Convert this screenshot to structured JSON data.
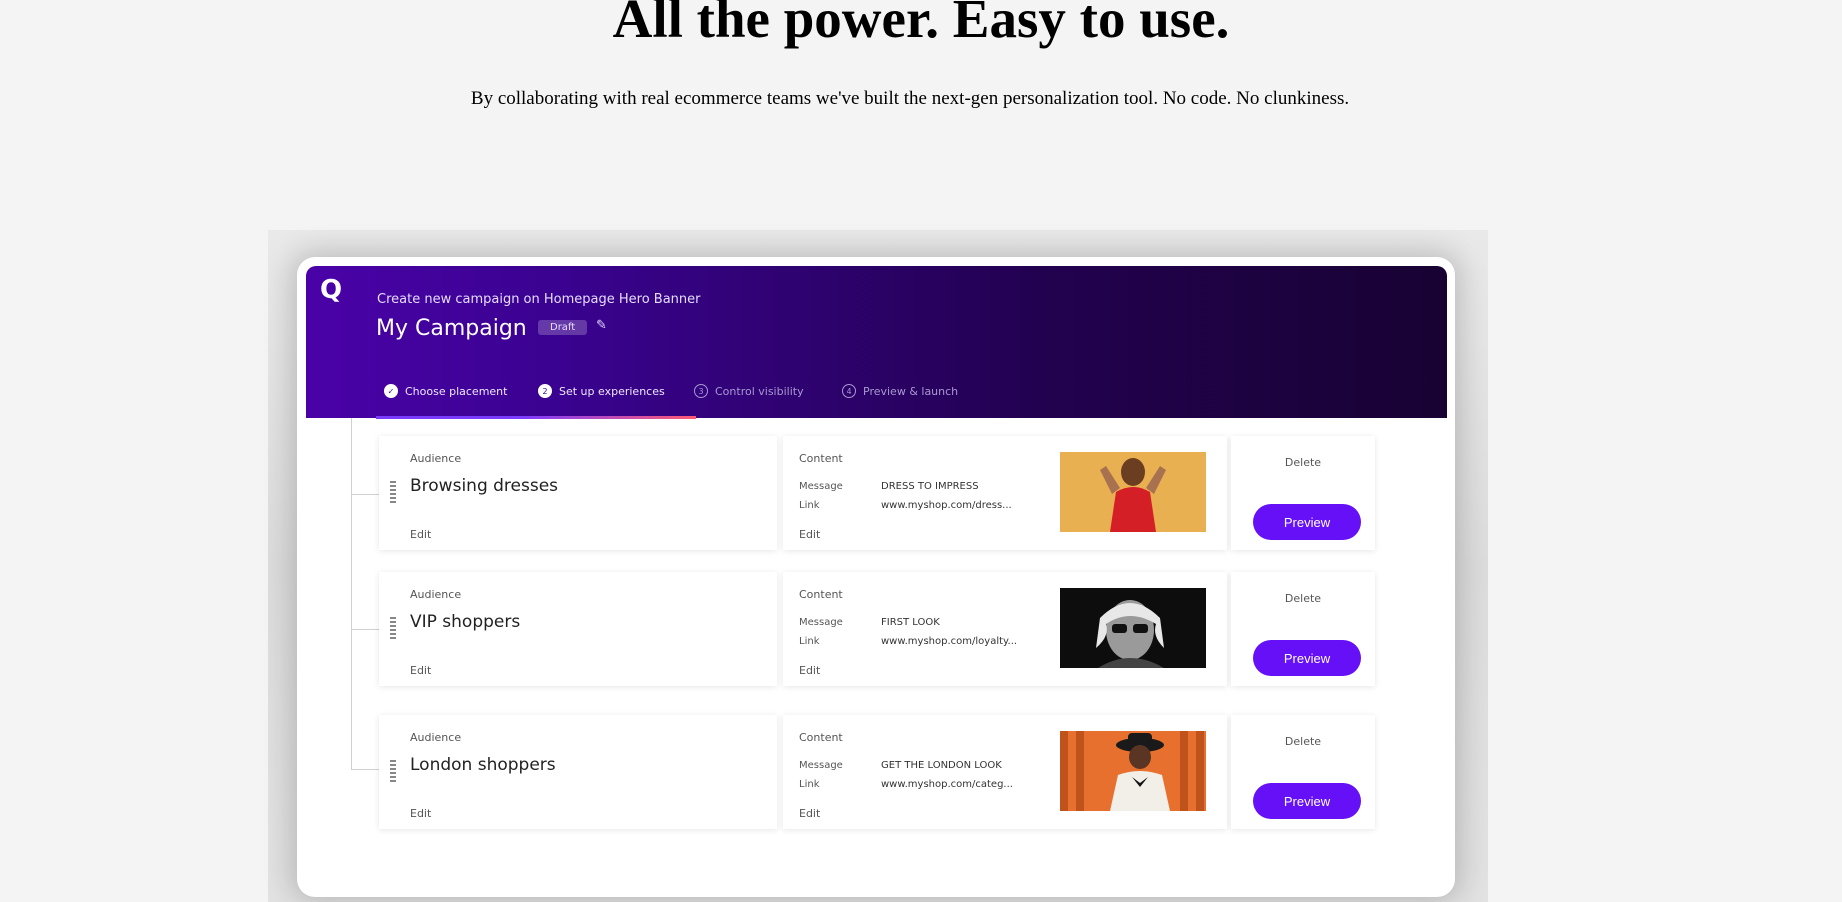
{
  "hero": {
    "title": "All the power. Easy to use.",
    "subtitle": "By collaborating with real ecommerce teams we've built the next-gen personalization tool. No code. No clunkiness."
  },
  "app": {
    "logo": "Q",
    "breadcrumb": "Create new campaign on Homepage Hero Banner",
    "campaign_title": "My Campaign",
    "status_badge": "Draft",
    "steps": [
      {
        "label": "Choose placement",
        "state": "done",
        "marker": "✓"
      },
      {
        "label": "Set up experiences",
        "state": "current",
        "marker": "2"
      },
      {
        "label": "Control visibility",
        "state": "todo",
        "marker": "3"
      },
      {
        "label": "Preview & launch",
        "state": "todo",
        "marker": "4"
      }
    ],
    "colors": {
      "header_start": "#4a02a8",
      "header_end": "#180233",
      "accent": "#6510f6"
    },
    "experiences": [
      {
        "audience_label": "Audience",
        "audience_name": "Browsing dresses",
        "audience_edit": "Edit",
        "content_label": "Content",
        "message_key": "Message",
        "message_value": "DRESS TO IMPRESS",
        "link_key": "Link",
        "link_value": "www.myshop.com/dress...",
        "content_edit": "Edit",
        "delete": "Delete",
        "preview": "Preview"
      },
      {
        "audience_label": "Audience",
        "audience_name": "VIP shoppers",
        "audience_edit": "Edit",
        "content_label": "Content",
        "message_key": "Message",
        "message_value": "FIRST LOOK",
        "link_key": "Link",
        "link_value": "www.myshop.com/loyalty...",
        "content_edit": "Edit",
        "delete": "Delete",
        "preview": "Preview"
      },
      {
        "audience_label": "Audience",
        "audience_name": "London shoppers",
        "audience_edit": "Edit",
        "content_label": "Content",
        "message_key": "Message",
        "message_value": "GET THE LONDON LOOK",
        "link_key": "Link",
        "link_value": "www.myshop.com/categ...",
        "content_edit": "Edit",
        "delete": "Delete",
        "preview": "Preview"
      }
    ]
  }
}
